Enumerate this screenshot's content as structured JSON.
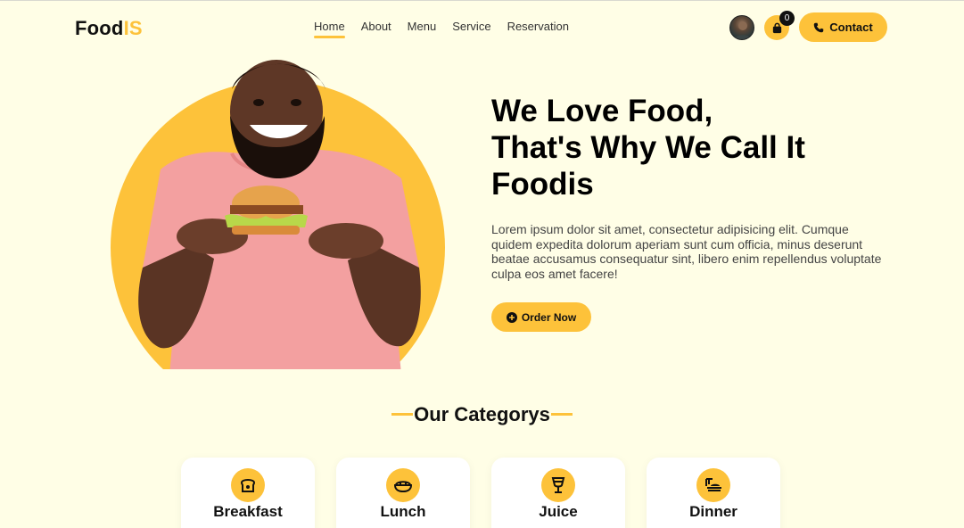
{
  "brand": {
    "name_main": "Food",
    "name_accent": "IS",
    "accent_color": "#fdc23a"
  },
  "nav": {
    "items": [
      {
        "label": "Home",
        "active": true
      },
      {
        "label": "About"
      },
      {
        "label": "Menu"
      },
      {
        "label": "Service"
      },
      {
        "label": "Reservation"
      }
    ]
  },
  "header": {
    "cart_count": "0",
    "contact_label": "Contact",
    "avatar_icon": "user-avatar",
    "cart_icon": "shopping-bag-icon",
    "contact_icon": "phone-icon"
  },
  "hero": {
    "title_lines": [
      "We Love Food,",
      "That's Why We Call It",
      "Foodis"
    ],
    "description": "Lorem ipsum dolor sit amet, consectetur adipisicing elit. Cumque quidem expedita dolorum aperiam sunt cum officia, minus deserunt beatae accusamus consequatur sint, libero enim repellendus voluptate culpa eos amet facere!",
    "cta_label": "Order Now",
    "cta_icon": "plus-circle-icon"
  },
  "categories": {
    "title": "Our Categorys",
    "items": [
      {
        "label": "Breakfast",
        "icon": "bread-icon"
      },
      {
        "label": "Lunch",
        "icon": "bowl-icon"
      },
      {
        "label": "Juice",
        "icon": "glass-icon"
      },
      {
        "label": "Dinner",
        "icon": "dish-icon"
      }
    ]
  }
}
